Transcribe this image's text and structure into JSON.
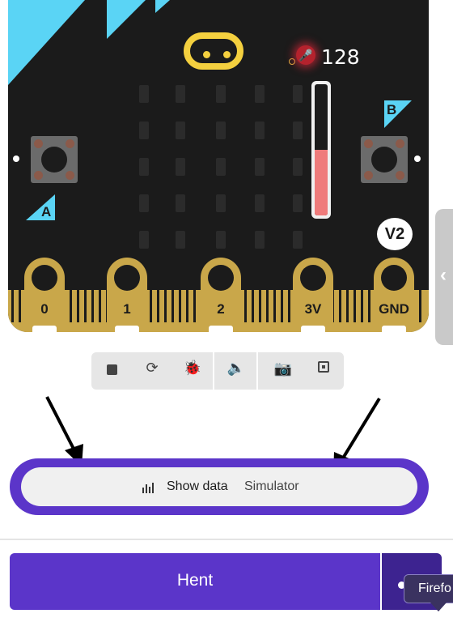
{
  "board": {
    "sound_level": "128",
    "button_a": "A",
    "button_b": "B",
    "version_badge": "V2",
    "pins": [
      "0",
      "1",
      "2",
      "3V",
      "GND"
    ],
    "sound_meter_fraction": 0.5
  },
  "toolbar": {
    "icons": [
      "stop-icon",
      "refresh-icon",
      "bug-icon",
      "speaker-icon",
      "camera-icon",
      "fullscreen-icon"
    ]
  },
  "show_data": {
    "label": "Show data",
    "sublabel": "Simulator"
  },
  "footer": {
    "download_label": "Hent",
    "tooltip": "Firefo"
  },
  "colors": {
    "board": "#1b1b1b",
    "accent_cyan": "#5ad4f5",
    "gold": "#c9a74a",
    "purple": "#5b35c9",
    "logo_yellow": "#f4d03f",
    "sound_fill": "#ef7b7b"
  }
}
